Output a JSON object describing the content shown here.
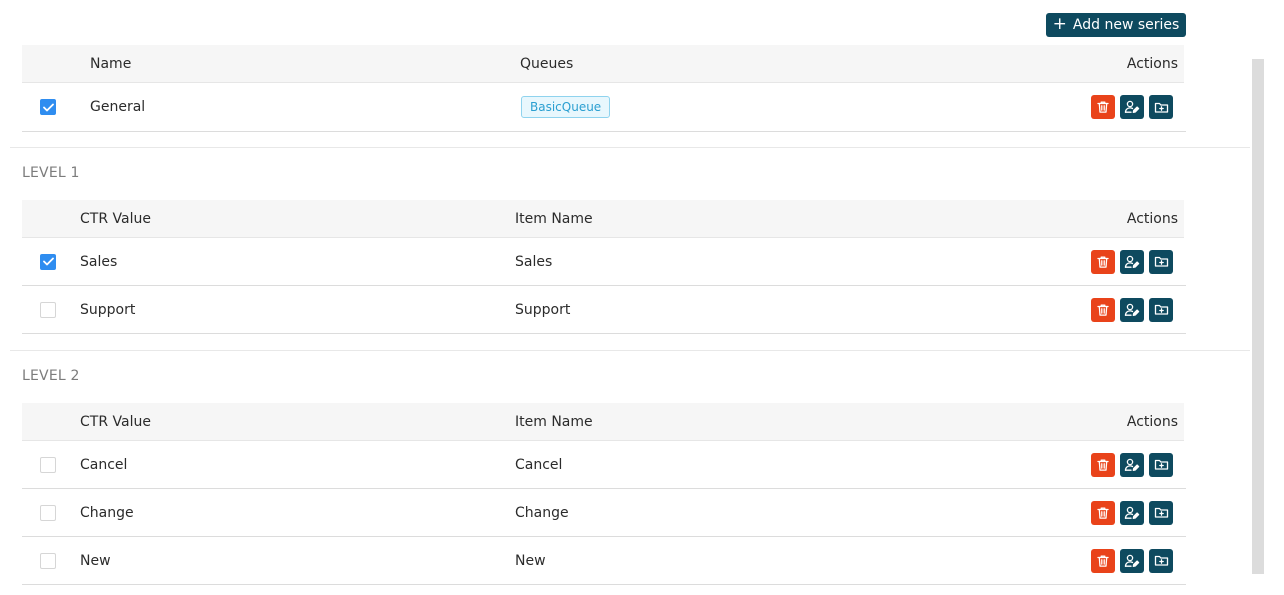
{
  "toolbar": {
    "add_label": "Add new series"
  },
  "colors": {
    "primary": "#0e4a5f",
    "danger": "#e9431a",
    "checkbox": "#2f8df0",
    "tag_text": "#2a9fd1"
  },
  "series_table": {
    "headers": {
      "name": "Name",
      "queues": "Queues",
      "actions": "Actions"
    },
    "rows": [
      {
        "checked": true,
        "name": "General",
        "queue": "BasicQueue"
      }
    ]
  },
  "level1": {
    "title": "LEVEL 1",
    "headers": {
      "ctr": "CTR Value",
      "item": "Item Name",
      "actions": "Actions"
    },
    "rows": [
      {
        "checked": true,
        "ctr": "Sales",
        "item": "Sales"
      },
      {
        "checked": false,
        "ctr": "Support",
        "item": "Support"
      }
    ]
  },
  "level2": {
    "title": "LEVEL 2",
    "headers": {
      "ctr": "CTR Value",
      "item": "Item Name",
      "actions": "Actions"
    },
    "rows": [
      {
        "checked": false,
        "ctr": "Cancel",
        "item": "Cancel"
      },
      {
        "checked": false,
        "ctr": "Change",
        "item": "Change"
      },
      {
        "checked": false,
        "ctr": "New",
        "item": "New"
      }
    ]
  },
  "icons": {
    "delete": "trash-icon",
    "assign": "user-edit-icon",
    "folder": "folder-add-icon",
    "add": "plus-icon",
    "check": "check-icon"
  }
}
